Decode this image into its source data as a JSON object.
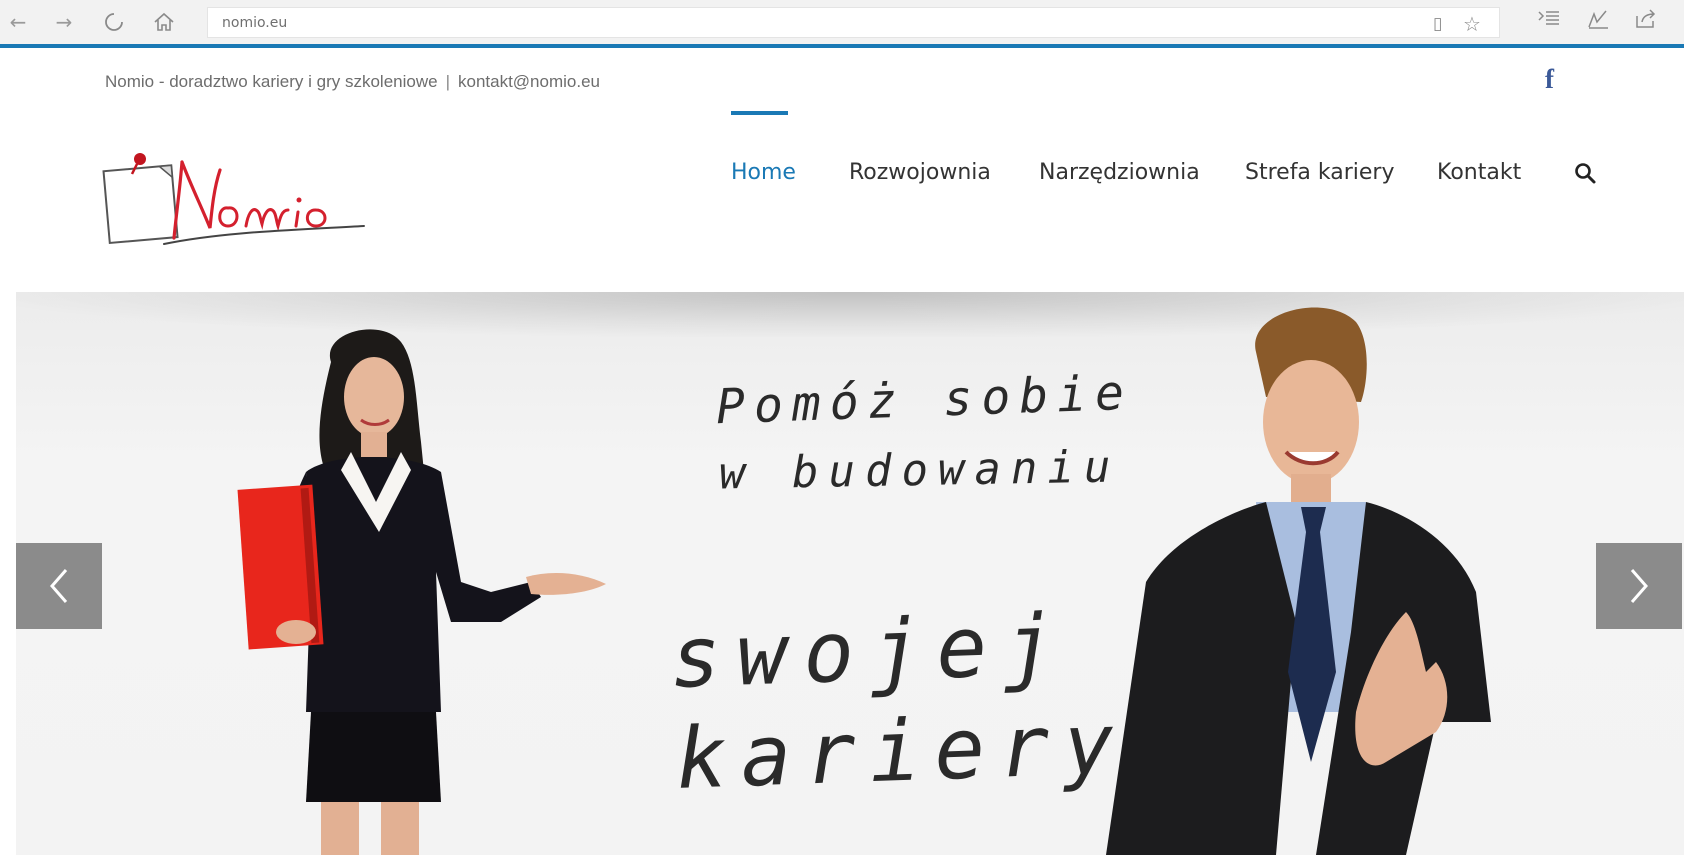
{
  "browser": {
    "url": "nomio.eu",
    "icons": [
      "back-arrow-icon",
      "forward-arrow-icon",
      "refresh-icon",
      "home-icon",
      "reading-view-icon",
      "favorite-star-icon",
      "hub-icon",
      "web-note-icon",
      "share-icon"
    ]
  },
  "topbar": {
    "tagline": "Nomio - doradztwo kariery i gry szkoleniowe",
    "separator": "|",
    "email": "kontakt@nomio.eu",
    "social_icon": "f"
  },
  "header": {
    "logo_text": "Nomio",
    "nav": [
      {
        "label": "Home",
        "active": true
      },
      {
        "label": "Rozwojownia",
        "active": false
      },
      {
        "label": "Narzędziownia",
        "active": false
      },
      {
        "label": "Strefa kariery",
        "active": false
      },
      {
        "label": "Kontakt",
        "active": false
      }
    ]
  },
  "hero": {
    "line1": "Pomóż sobie",
    "line2": "w budowaniu",
    "line3": "swojej",
    "line4": "kariery"
  },
  "colors": {
    "accent": "#1a79b5",
    "logo_red": "#d4202e",
    "facebook": "#3b5998",
    "arrow_bg": "#8b8b8b",
    "folder_red": "#e8261c"
  }
}
